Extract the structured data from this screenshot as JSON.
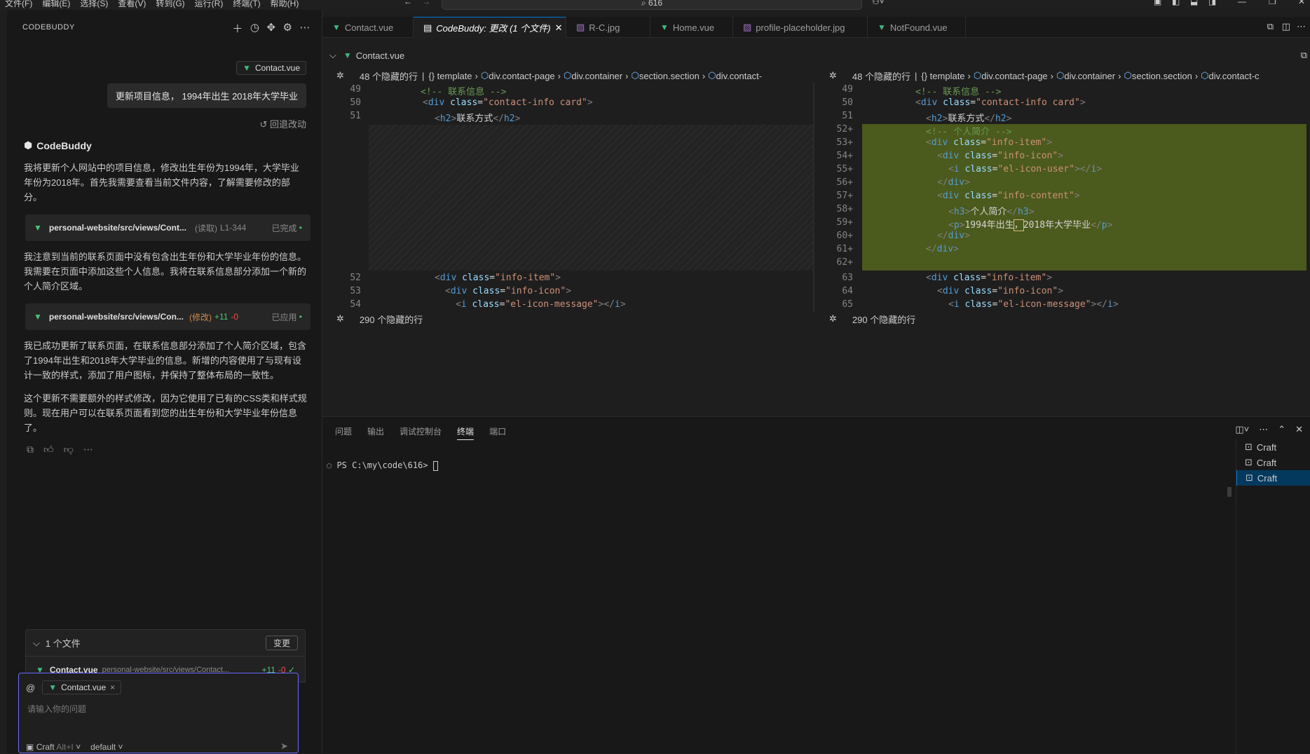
{
  "menubar": {
    "items": [
      "文件(F)",
      "编辑(E)",
      "选择(S)",
      "查看(V)",
      "转到(G)",
      "运行(R)",
      "终端(T)",
      "帮助(H)"
    ]
  },
  "search": {
    "text": "616"
  },
  "sidebar": {
    "title": "CODEBUDDY",
    "context_chip": "Contact.vue",
    "user_message": "更新项目信息， 1994年出生 2018年大学毕业",
    "revert_label": "回退改动",
    "assistant_name": "CodeBuddy",
    "para1": "我将更新个人网站中的项目信息，修改出生年份为1994年，大学毕业年份为2018年。首先我需要查看当前文件内容，了解需要修改的部分。",
    "tool1": {
      "path": "personal-website/src/views/Cont...",
      "action": "(读取)",
      "range": "L1-344",
      "status": "已完成"
    },
    "para2": "我注意到当前的联系页面中没有包含出生年份和大学毕业年份的信息。我需要在页面中添加这些个人信息。我将在联系信息部分添加一个新的个人简介区域。",
    "tool2": {
      "path": "personal-website/src/views/Con...",
      "action": "(修改)",
      "added": "+11",
      "removed": "-0",
      "status": "已应用"
    },
    "para3": "我已成功更新了联系页面，在联系信息部分添加了个人简介区域，包含了1994年出生和2018年大学毕业的信息。新增的内容使用了与现有设计一致的样式，添加了用户图标，并保持了整体布局的一致性。",
    "para4": "这个更新不需要额外的样式修改，因为它使用了已有的CSS类和样式规则。现在用户可以在联系页面看到您的出生年份和大学毕业年份信息了。",
    "files_header": "1 个文件",
    "changes_button": "变更",
    "file_name": "Contact.vue",
    "file_path": "personal-website/src/views/Contact...",
    "file_added": "+11",
    "file_removed": "-0",
    "input_chip": "Contact.vue",
    "input_placeholder": "请输入你的问题",
    "mode_label": "Craft",
    "mode_shortcut": "Alt+I",
    "model_label": "default"
  },
  "tabs": [
    {
      "label": "Contact.vue",
      "icon": "vue"
    },
    {
      "label": "CodeBuddy: 更改 (1 个文件)",
      "icon": "diff",
      "active": true
    },
    {
      "label": "R-C.jpg",
      "icon": "image"
    },
    {
      "label": "Home.vue",
      "icon": "vue"
    },
    {
      "label": "profile-placeholder.jpg",
      "icon": "image"
    },
    {
      "label": "NotFound.vue",
      "icon": "vue"
    }
  ],
  "editor": {
    "file_title": "Contact.vue",
    "hidden_top": "48 个隐藏的行",
    "hidden_bottom": "290 个隐藏的行",
    "breadcrumbs": [
      "{} template",
      "div.contact-page",
      "div.container",
      "section.section",
      "div.contact-"
    ],
    "breadcrumbs_right": [
      "{} template",
      "div.contact-page",
      "div.container",
      "section.section",
      "div.contact-c"
    ],
    "left_nums_top": [
      "49",
      "50",
      "51"
    ],
    "left_nums_bottom": [
      "52",
      "53",
      "54"
    ],
    "right_nums": [
      "49",
      "50",
      "51",
      "52+",
      "53+",
      "54+",
      "55+",
      "56+",
      "57+",
      "58+",
      "59+",
      "60+",
      "61+",
      "62+",
      "63",
      "64",
      "65"
    ]
  },
  "panel": {
    "tabs": [
      "问题",
      "输出",
      "调试控制台",
      "终端",
      "端口"
    ],
    "active_tab": "终端",
    "prompt": "PS C:\\my\\code\\616>",
    "terminals": [
      "Craft",
      "Craft",
      "Craft"
    ]
  }
}
